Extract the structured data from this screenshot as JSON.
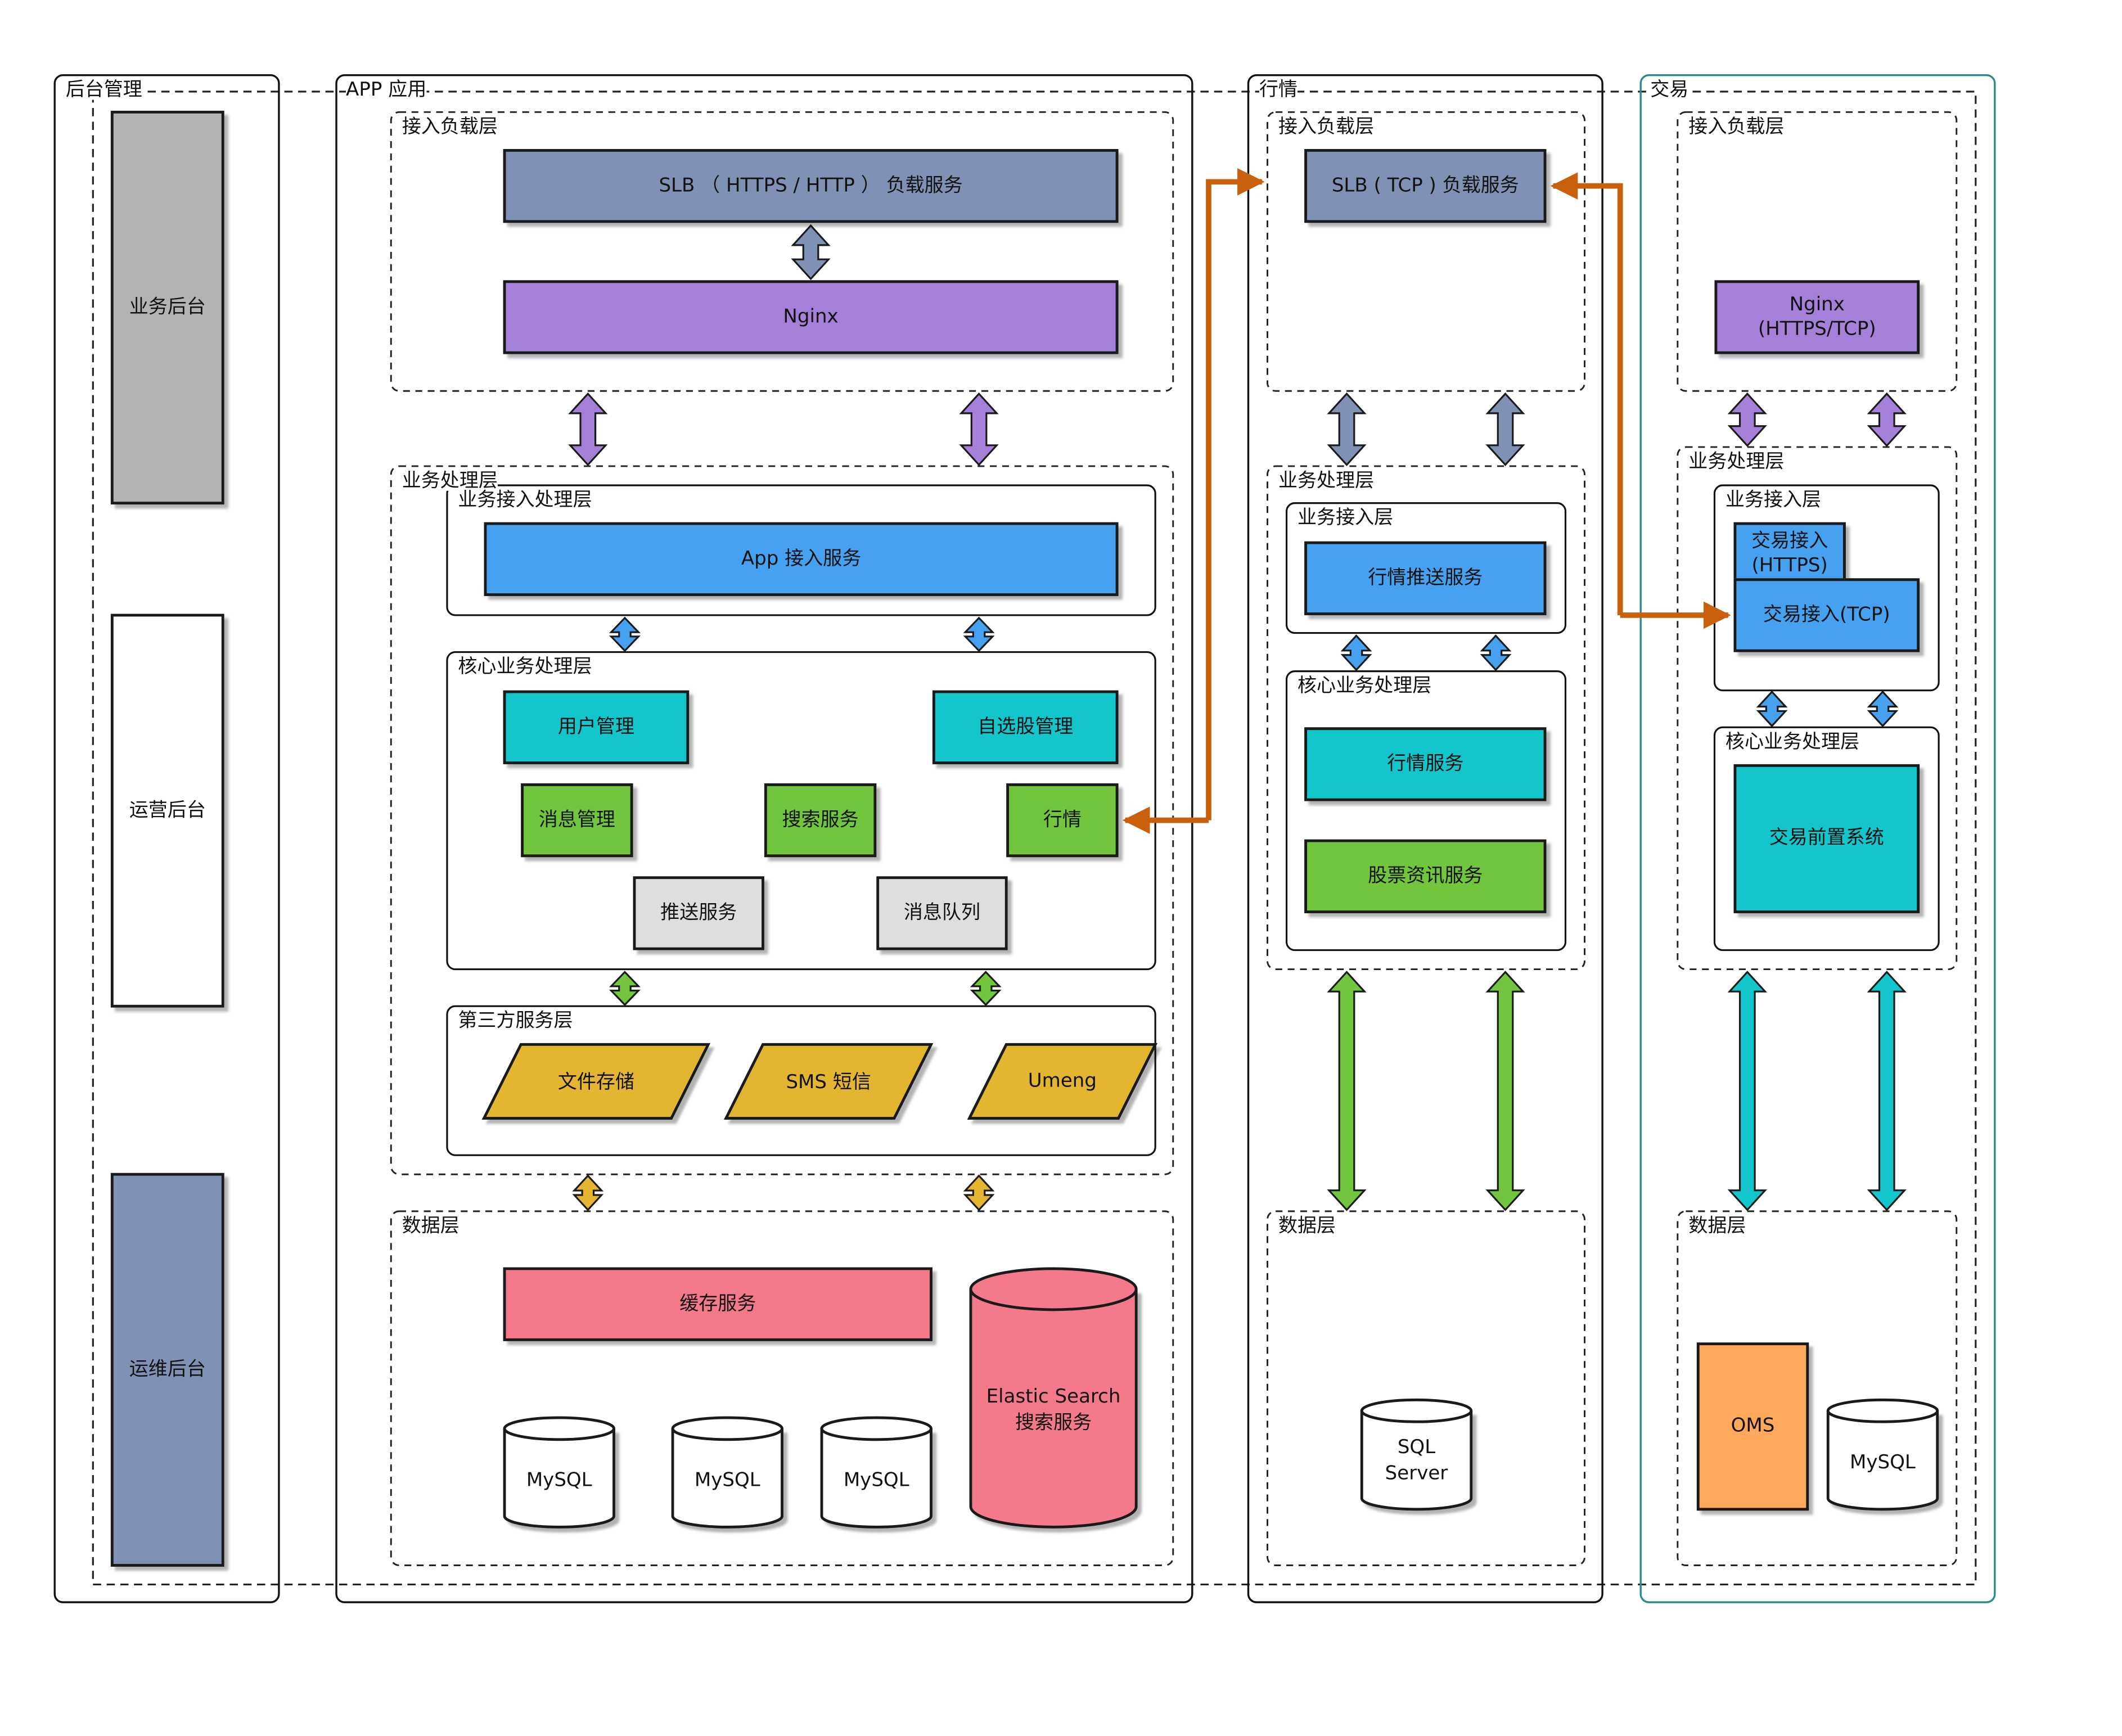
{
  "sections": {
    "admin": {
      "title": "后台管理",
      "business": "业务后台",
      "operations": "运营后台",
      "maintenance": "运维后台"
    },
    "app": {
      "title": "APP 应用",
      "access_layer": "接入负载层",
      "slb": "SLB （ HTTPS / HTTP ） 负载服务",
      "nginx": "Nginx",
      "biz_layer": "业务处理层",
      "biz_access_layer": "业务接入处理层",
      "app_access": "App 接入服务",
      "core_layer": "核心业务处理层",
      "user_mgmt": "用户管理",
      "watchlist_mgmt": "自选股管理",
      "msg_mgmt": "消息管理",
      "search_service": "搜索服务",
      "market": "行情",
      "push_service": "推送服务",
      "msg_queue": "消息队列",
      "third_party_layer": "第三方服务层",
      "file_storage": "文件存储",
      "sms": "SMS 短信",
      "umeng": "Umeng",
      "data_layer": "数据层",
      "cache": "缓存服务",
      "mysql": "MySQL",
      "es_line1": "Elastic Search",
      "es_line2": "搜索服务"
    },
    "market": {
      "title": "行情",
      "access_layer": "接入负载层",
      "slb": "SLB ( TCP ) 负载服务",
      "biz_layer": "业务处理层",
      "biz_access_layer": "业务接入层",
      "push": "行情推送服务",
      "core_layer": "核心业务处理层",
      "market_service": "行情服务",
      "stock_info": "股票资讯服务",
      "data_layer": "数据层",
      "sql_line1": "SQL",
      "sql_line2": "Server"
    },
    "trade": {
      "title": "交易",
      "access_layer": "接入负载层",
      "nginx_line1": "Nginx",
      "nginx_line2": "(HTTPS/TCP)",
      "biz_layer": "业务处理层",
      "biz_access_layer": "业务接入层",
      "https_line1": "交易接入",
      "https_line2": "(HTTPS)",
      "tcp": "交易接入(TCP)",
      "core_layer": "核心业务处理层",
      "front_system": "交易前置系统",
      "data_layer": "数据层",
      "oms": "OMS",
      "mysql": "MySQL"
    }
  },
  "colors": {
    "slb": "#7f92b6",
    "nginx": "#a580d8",
    "blue": "#46a2f1",
    "teal": "#13c6cb",
    "green": "#72c63e",
    "gray": "#dedede",
    "yellow": "#e3b530",
    "pink": "#f47a8b",
    "orange_box": "#fda85b",
    "orange_arrow": "#c8600e",
    "trade_border": "#2e8b85"
  }
}
